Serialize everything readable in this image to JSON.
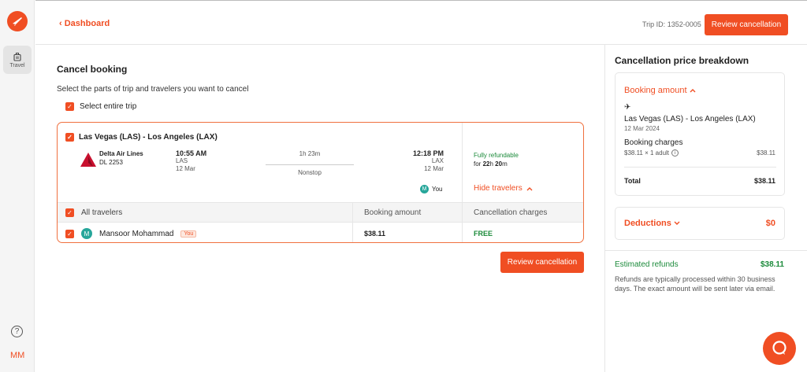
{
  "rail": {
    "travel_label": "Travel",
    "user_initials": "MM",
    "help_glyph": "?"
  },
  "header": {
    "back_label": "Dashboard",
    "trip_id_label": "Trip ID:",
    "trip_id_value": "1352-0005",
    "review_button": "Review cancellation"
  },
  "main": {
    "title": "Cancel booking",
    "subtitle": "Select the parts of trip and travelers you want to cancel",
    "select_entire_trip": "Select entire trip",
    "flight": {
      "route": "Las Vegas (LAS) - Los Angeles (LAX)",
      "airline": "Delta Air Lines",
      "flight_no": "DL 2253",
      "dep_time": "10:55 AM",
      "dep_code": "LAS",
      "dep_date": "12 Mar",
      "duration": "1h 23m",
      "stops": "Nonstop",
      "arr_time": "12:18 PM",
      "arr_code": "LAX",
      "arr_date": "12 Mar",
      "refund_status": "Fully refundable",
      "refund_for": "for",
      "refund_hours": "22",
      "refund_hours_unit": "h",
      "refund_minutes": "20",
      "refund_minutes_unit": "m",
      "you_initial": "M",
      "you_label": "You",
      "hide_travelers": "Hide travelers"
    },
    "table": {
      "headers": [
        "All travelers",
        "Booking amount",
        "Cancellation charges"
      ],
      "rows": [
        {
          "initial": "M",
          "name": "Mansoor Mohammad",
          "badge": "You",
          "amount": "$38.11",
          "charges": "FREE"
        }
      ]
    },
    "review_button": "Review cancellation"
  },
  "breakdown": {
    "title": "Cancellation price breakdown",
    "booking_amount_label": "Booking amount",
    "route": "Las Vegas (LAS) - Los Angeles (LAX)",
    "date": "12 Mar 2024",
    "booking_charges_label": "Booking charges",
    "calc": "$38.11 × 1 adult",
    "calc_value": "$38.11",
    "total_label": "Total",
    "total_value": "$38.11",
    "deductions_label": "Deductions",
    "deductions_value": "$0",
    "estimated_label": "Estimated refunds",
    "estimated_value": "$38.11",
    "note": "Refunds are typically processed within 30 business days. The exact amount will be sent later via email."
  },
  "colors": {
    "accent": "#f04e23",
    "success": "#1b8a3a",
    "avatar": "#26a69a"
  }
}
